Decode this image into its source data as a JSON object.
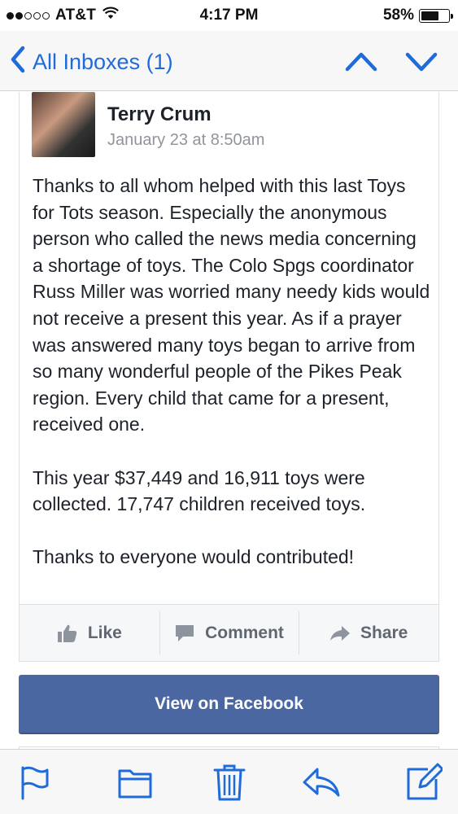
{
  "status_bar": {
    "carrier": "AT&T",
    "time": "4:17 PM",
    "battery": "58%",
    "signal_bars_filled": 2,
    "signal_bars_total": 5
  },
  "nav": {
    "back_label": "All Inboxes (1)",
    "icons": [
      "chevron-left-icon",
      "chevron-up-icon",
      "chevron-down-icon"
    ]
  },
  "post": {
    "author": "Terry Crum",
    "date": "January 23 at 8:50am",
    "paragraphs": [
      "Thanks to all whom helped with this last Toys for Tots season. Especially the anonymous person who called the news media concerning a shortage of toys. The Colo Spgs coordinator Russ Miller was worried many needy kids would not receive a present this year. As if a prayer was answered many toys began to arrive from so many wonderful people of the Pikes Peak region. Every child that came for a present, received one.",
      "This year $37,449 and 16,911 toys were collected. 17,747 children received toys.",
      "Thanks to everyone would contributed!"
    ]
  },
  "actions": {
    "like": "Like",
    "comment": "Comment",
    "share": "Share"
  },
  "view_on_facebook": "View on Facebook",
  "toolbar": {
    "icons": [
      "flag-icon",
      "folder-icon",
      "trash-icon",
      "reply-icon",
      "compose-icon"
    ]
  },
  "colors": {
    "accent": "#1f6bd9",
    "facebook_blue": "#4b67a1",
    "text": "#1d2129",
    "muted": "#90949c"
  }
}
